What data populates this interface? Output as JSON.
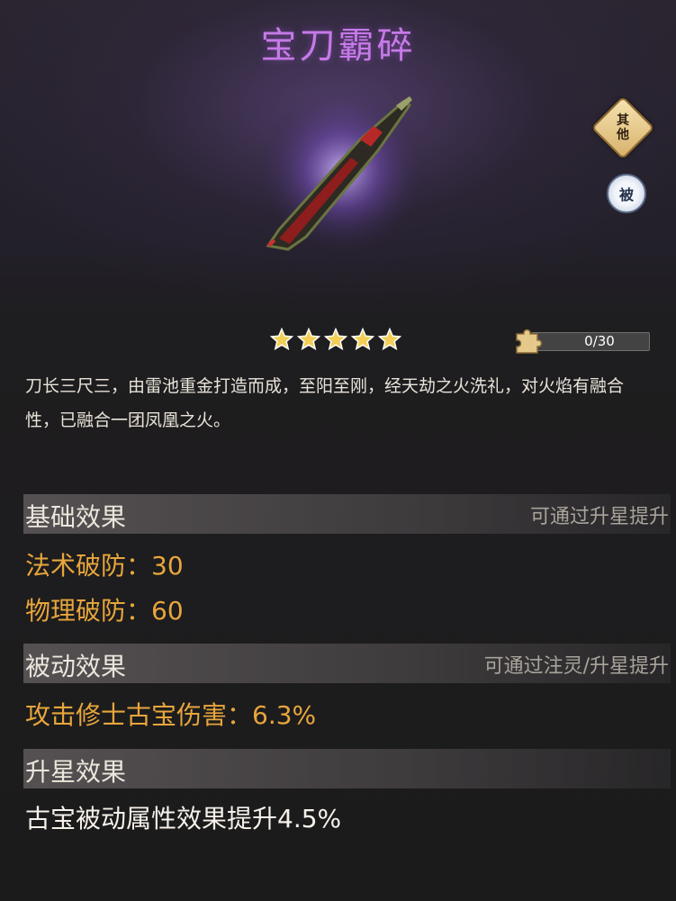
{
  "item": {
    "name": "宝刀霸碎",
    "rarity_stars": 5,
    "description": "刀长三尺三，由雷池重金打造而成，至阳至刚，经天劫之火洗礼，对火焰有融合性，已融合一团凤凰之火。"
  },
  "badges": {
    "category_label": "其他",
    "type_label": "被"
  },
  "fragments": {
    "text": "0/30",
    "progress_fraction": 0
  },
  "sections": {
    "basic": {
      "title": "基础效果",
      "hint": "可通过升星提升",
      "attributes": [
        {
          "label": "法术破防：30"
        },
        {
          "label": "物理破防：60"
        }
      ]
    },
    "passive": {
      "title": "被动效果",
      "hint": "可通过注灵/升星提升",
      "attributes": [
        {
          "label": "攻击修士古宝伤害：6.3%"
        }
      ]
    },
    "star_up": {
      "title": "升星效果",
      "text": "古宝被动属性效果提升4.5%"
    }
  },
  "colors": {
    "title": "#c67ae8",
    "attribute": "#e7a63c",
    "star": "#f3cf57",
    "fragment_fill": "#d8b26c"
  },
  "icons": [
    "weapon-image",
    "other-category-icon",
    "passive-icon",
    "star-icon",
    "puzzle-piece-icon"
  ]
}
